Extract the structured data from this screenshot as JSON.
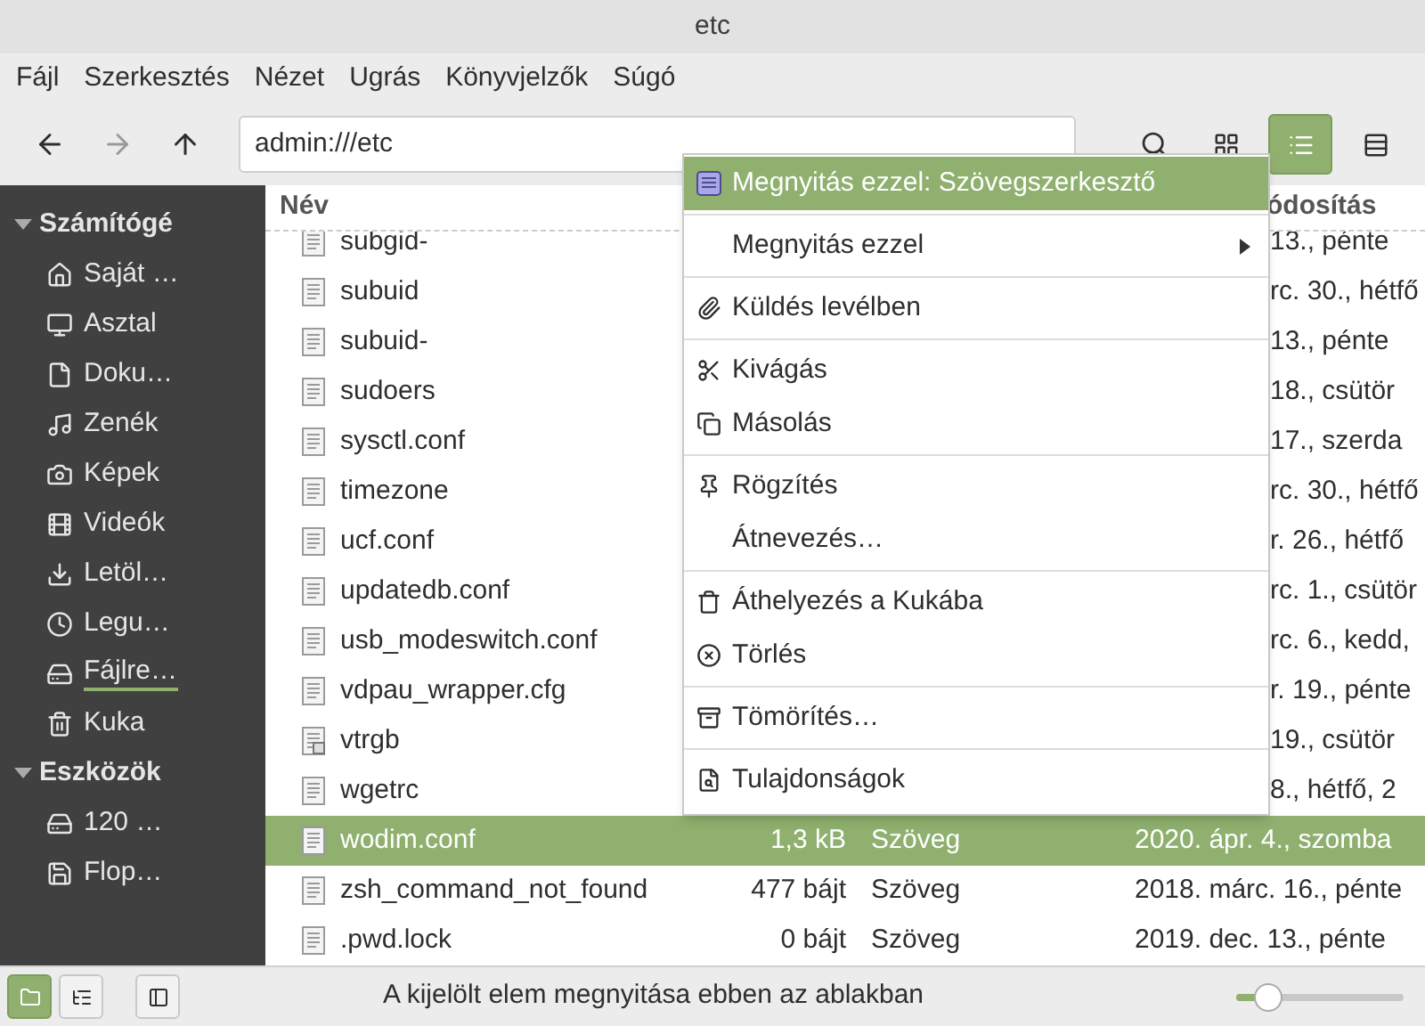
{
  "window": {
    "title": "etc"
  },
  "menubar": [
    "Fájl",
    "Szerkesztés",
    "Nézet",
    "Ugrás",
    "Könyvjelzők",
    "Súgó"
  ],
  "toolbar": {
    "location": "admin:///etc",
    "view_buttons": [
      {
        "selected": false
      },
      {
        "selected": true
      },
      {
        "selected": false
      }
    ]
  },
  "sidebar": {
    "sections": [
      {
        "title": "Számítógé",
        "expanded": true,
        "items": [
          {
            "label": "Saját …",
            "selected": false
          },
          {
            "label": "Asztal",
            "selected": false
          },
          {
            "label": "Doku…",
            "selected": false
          },
          {
            "label": "Zenék",
            "selected": false
          },
          {
            "label": "Képek",
            "selected": false
          },
          {
            "label": "Videók",
            "selected": false
          },
          {
            "label": "Letöl…",
            "selected": false
          },
          {
            "label": "Legu…",
            "selected": false
          },
          {
            "label": "Fájlre…",
            "selected": true
          },
          {
            "label": "Kuka",
            "selected": false
          }
        ]
      },
      {
        "title": "Eszközök",
        "expanded": true,
        "items": [
          {
            "label": "120 …",
            "selected": false
          },
          {
            "label": "Flop…",
            "selected": false
          }
        ]
      }
    ]
  },
  "table": {
    "columns": [
      "Név",
      "ódosítás"
    ],
    "rows": [
      {
        "name": "subgid-",
        "date": "13., pénte",
        "selected": false,
        "link": false
      },
      {
        "name": "subuid",
        "date": "rc. 30., hétfő",
        "selected": false,
        "link": false
      },
      {
        "name": "subuid-",
        "date": "13., pénte",
        "selected": false,
        "link": false
      },
      {
        "name": "sudoers",
        "date": "18., csütör",
        "selected": false,
        "link": false
      },
      {
        "name": "sysctl.conf",
        "date": "17., szerda",
        "selected": false,
        "link": false
      },
      {
        "name": "timezone",
        "date": "rc. 30., hétfő",
        "selected": false,
        "link": false
      },
      {
        "name": "ucf.conf",
        "date": "r. 26., hétfő",
        "selected": false,
        "link": false
      },
      {
        "name": "updatedb.conf",
        "date": "rc. 1., csütör",
        "selected": false,
        "link": false
      },
      {
        "name": "usb_modeswitch.conf",
        "date": "rc. 6., kedd,",
        "selected": false,
        "link": false
      },
      {
        "name": "vdpau_wrapper.cfg",
        "date": "r. 19., pénte",
        "selected": false,
        "link": false
      },
      {
        "name": "vtrgb",
        "date": "19., csütör",
        "selected": false,
        "link": true
      },
      {
        "name": "wgetrc",
        "date": "8., hétfő, 2",
        "selected": false,
        "link": false
      },
      {
        "name": "wodim.conf",
        "size": "1,3 kB",
        "type": "Szöveg",
        "date": "2020. ápr. 4., szomba",
        "selected": true,
        "link": false
      },
      {
        "name": "zsh_command_not_found",
        "size": "477 bájt",
        "type": "Szöveg",
        "date": "2018. márc. 16., pénte",
        "selected": false,
        "link": false
      },
      {
        "name": ".pwd.lock",
        "size": "0 bájt",
        "type": "Szöveg",
        "date": "2019. dec. 13., pénte",
        "selected": false,
        "link": false
      }
    ]
  },
  "context_menu": {
    "groups": [
      [
        {
          "label": "Megnyitás ezzel: Szövegszerkesztő",
          "selected": true,
          "submenu": false
        }
      ],
      [
        {
          "label": "Megnyitás ezzel",
          "selected": false,
          "submenu": true
        }
      ],
      [
        {
          "label": "Küldés levélben",
          "selected": false,
          "submenu": false
        }
      ],
      [
        {
          "label": "Kivágás",
          "selected": false,
          "submenu": false
        },
        {
          "label": "Másolás",
          "selected": false,
          "submenu": false
        }
      ],
      [
        {
          "label": "Rögzítés",
          "selected": false,
          "submenu": false
        },
        {
          "label": "Átnevezés…",
          "selected": false,
          "submenu": false
        }
      ],
      [
        {
          "label": "Áthelyezés a Kukába",
          "selected": false,
          "submenu": false
        },
        {
          "label": "Törlés",
          "selected": false,
          "submenu": false
        }
      ],
      [
        {
          "label": "Tömörítés…",
          "selected": false,
          "submenu": false
        }
      ],
      [
        {
          "label": "Tulajdonságok",
          "selected": false,
          "submenu": false
        }
      ]
    ]
  },
  "status_bar": {
    "buttons": [
      {
        "selected": true
      },
      {
        "selected": false
      },
      {
        "selected": false
      }
    ],
    "message": "A kijelölt elem megnyitása ebben az ablakban",
    "zoom": {
      "level": 0.15
    }
  }
}
